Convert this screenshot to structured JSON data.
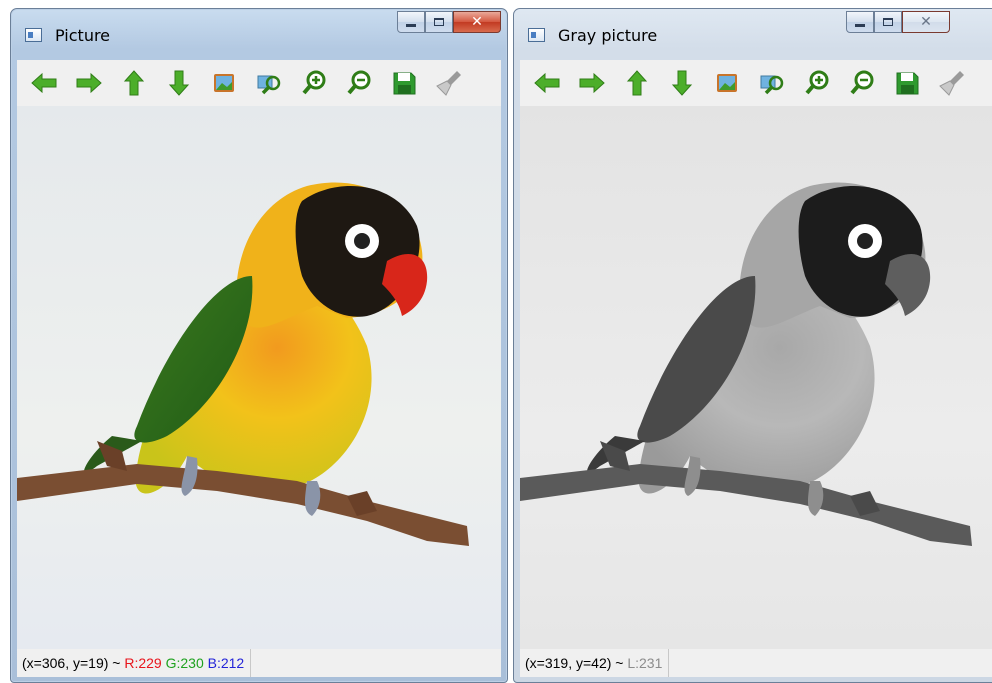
{
  "windows": [
    {
      "title": "Picture",
      "status": {
        "coords": "(x=306, y=19) ~",
        "r": "R:229",
        "g": "G:230",
        "b": "B:212"
      },
      "colors": {
        "r": "#e8141c",
        "g": "#1fa21f",
        "b": "#2424d8"
      }
    },
    {
      "title": "Gray picture",
      "status": {
        "coords": "(x=319, y=42) ~",
        "l": "L:231"
      },
      "colors": {
        "l": "#8c8c8c"
      }
    }
  ],
  "controls": {
    "minimize": "minimize",
    "maximize": "maximize",
    "close_symbol": "✕"
  },
  "toolbar_icons": [
    "arrow-left-icon",
    "arrow-right-icon",
    "arrow-up-icon",
    "arrow-down-icon",
    "image-icon",
    "zoom-fit-icon",
    "zoom-in-icon",
    "zoom-out-icon",
    "save-icon",
    "brush-icon"
  ],
  "accent": {
    "toolbar_green": "#4cae2a",
    "sky": "#e6ecf4"
  }
}
